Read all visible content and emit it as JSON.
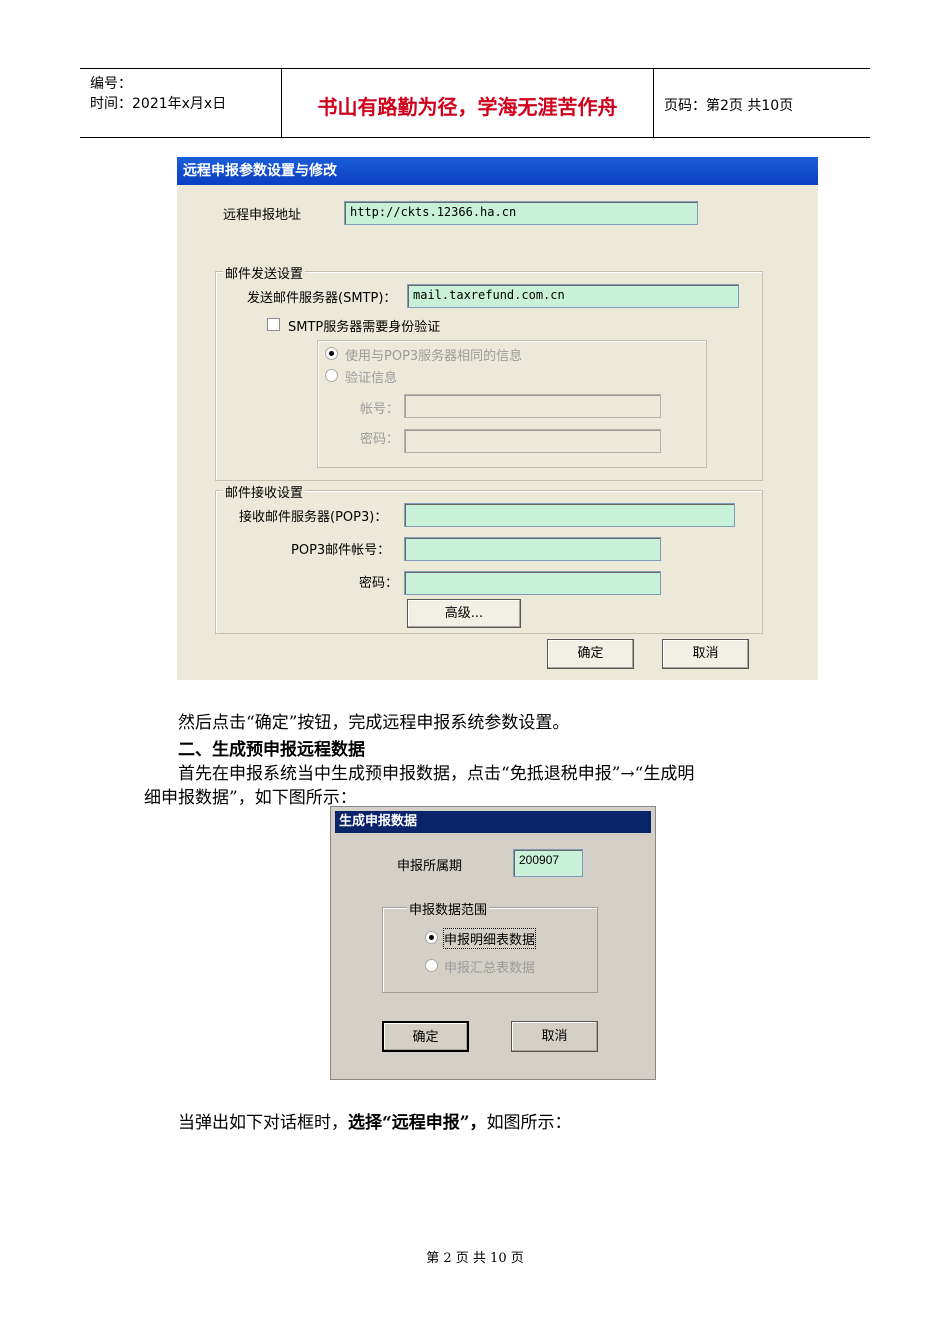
{
  "header": {
    "number_label": "编号：",
    "time_label": "时间：2021年x月x日",
    "motto": "书山有路勤为径，学海无涯苦作舟",
    "page_label": "页码：第2页  共10页"
  },
  "dialog1": {
    "title": "远程申报参数设置与修改",
    "address_label": "远程申报地址",
    "address_value": "http://ckts.12366.ha.cn",
    "mail_send": {
      "group_title": "邮件发送设置",
      "smtp_label": "发送邮件服务器(SMTP)：",
      "smtp_value": "mail.taxrefund.com.cn",
      "auth_checkbox_label": "SMTP服务器需要身份验证",
      "radio_same_label": "使用与POP3服务器相同的信息",
      "radio_auth_label": "验证信息",
      "account_label": "帐号：",
      "password_label": "密码："
    },
    "mail_receive": {
      "group_title": "邮件接收设置",
      "pop3_label": "接收邮件服务器(POP3)：",
      "pop3_account_label": "POP3邮件帐号：",
      "password_label": "密码：",
      "advanced_button": "高级..."
    },
    "ok_button": "确定",
    "cancel_button": "取消"
  },
  "text": {
    "para1": "然后点击“确定”按钮，完成远程申报系统参数设置。",
    "heading2": "二、生成预申报远程数据",
    "para2_line1": "首先在申报系统当中生成预申报数据，点击“免抵退税申报”→“生成明",
    "para2_line2": "细申报数据”，如下图所示：",
    "para3_normal": "当弹出如下对话框时，",
    "para3_bold": "选择“远程申报”，",
    "para3_tail": "如图所示："
  },
  "dialog2": {
    "title": "生成申报数据",
    "period_label": "申报所属期",
    "period_value": "200907",
    "group_title": "申报数据范围",
    "radio_detail_label": "申报明细表数据",
    "radio_summary_label": "申报汇总表数据",
    "ok_button": "确定",
    "cancel_button": "取消"
  },
  "footer": {
    "page_text": "第 2 页 共 10 页"
  }
}
